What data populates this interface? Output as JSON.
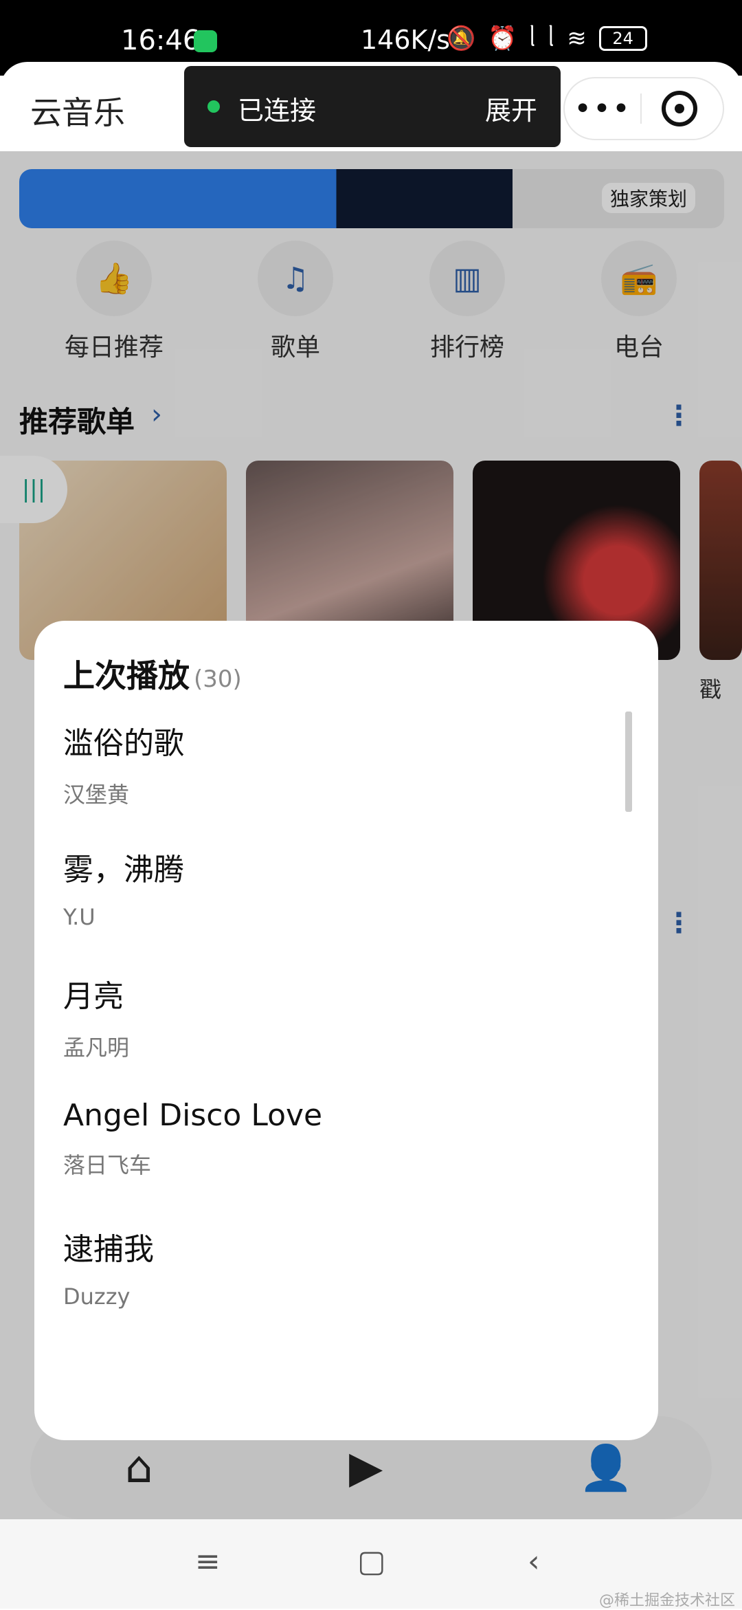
{
  "status_bar": {
    "time": "16:46",
    "speed": "146K/s",
    "battery": "24",
    "icons": [
      "wechat-icon",
      "mute-icon",
      "alarm-icon",
      "signal-icon",
      "signal-icon",
      "wifi-icon",
      "battery-icon"
    ]
  },
  "header": {
    "title": "云音乐",
    "capsule": {
      "more_label": "•••",
      "exit_icon": "target-circle-icon"
    }
  },
  "toast": {
    "status_text": "已连接",
    "expand_label": "展开",
    "status_color": "#22c55e"
  },
  "banner": {
    "tag": "独家策划"
  },
  "quick_entries": [
    {
      "label": "每日推荐",
      "icon": "thumbs-up-icon"
    },
    {
      "label": "歌单",
      "icon": "playlist-icon"
    },
    {
      "label": "排行榜",
      "icon": "chart-bars-icon"
    },
    {
      "label": "电台",
      "icon": "radio-icon"
    }
  ],
  "recommended": {
    "title": "推荐歌单",
    "arrow": "›",
    "more": "⋮",
    "partial_text": "戳"
  },
  "sheet": {
    "title": "上次播放",
    "count": "(30)",
    "songs": [
      {
        "title": "滥俗的歌",
        "artist": "汉堡黄"
      },
      {
        "title": "雾，沸腾",
        "artist": "Y.U"
      },
      {
        "title": "月亮",
        "artist": "孟凡明"
      },
      {
        "title": "Angel Disco Love",
        "artist": "落日飞车"
      },
      {
        "title": "逮捕我",
        "artist": "Duzzy"
      }
    ]
  },
  "tabbar": [
    "home-icon",
    "play-square-icon",
    "user-icon"
  ],
  "navbar": {
    "menu_icon": "≡",
    "home_icon": "▢",
    "back_icon": "‹",
    "watermark": "@稀土掘金技术社区"
  },
  "colors": {
    "accent": "#2f5fa8",
    "connected": "#22c55e"
  }
}
